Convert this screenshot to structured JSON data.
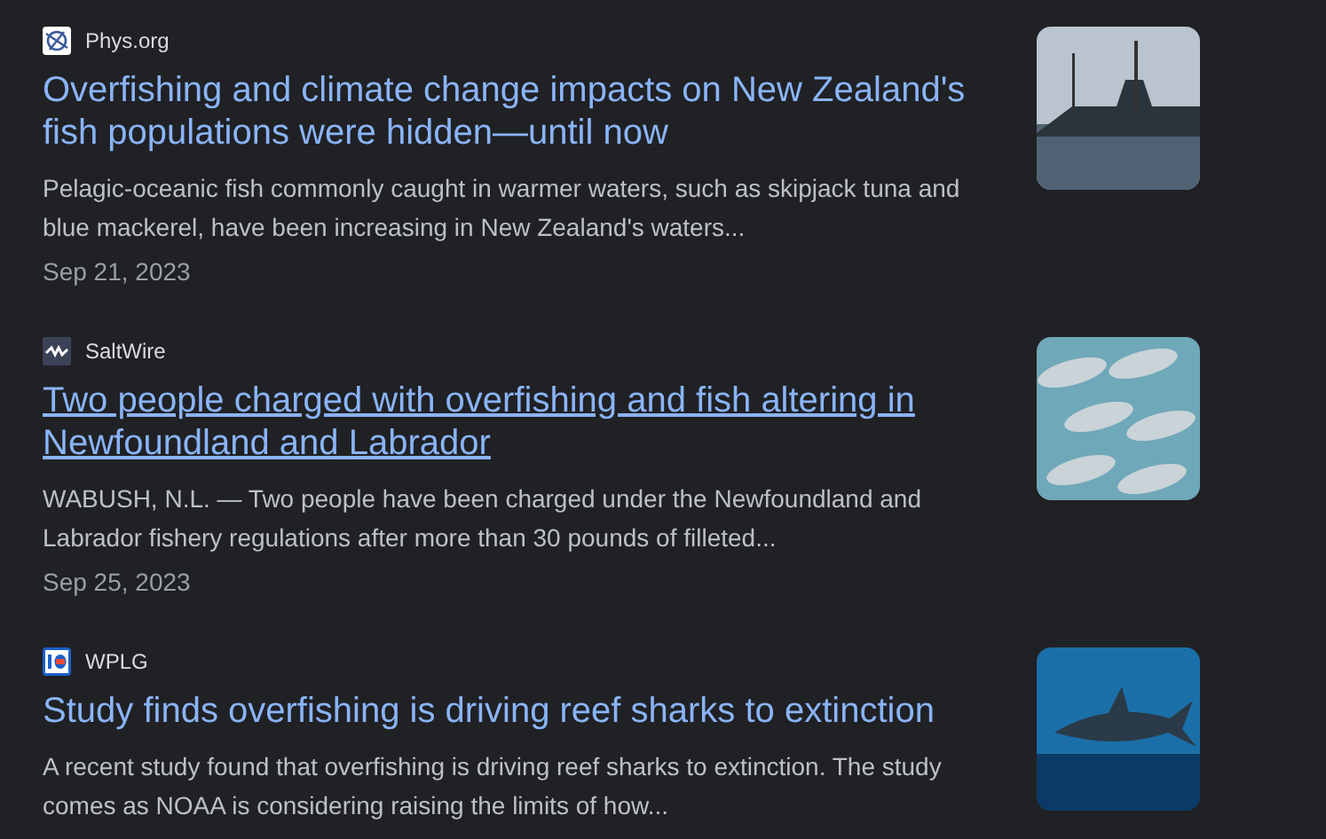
{
  "results": [
    {
      "source": "Phys.org",
      "logo": {
        "kind": "globe"
      },
      "title": "Overfishing and climate change impacts on New Zealand's fish populations were hidden—until now",
      "hovered": false,
      "snippet": "Pelagic-oceanic fish commonly caught in warmer waters, such as skipjack tuna and blue mackerel, have been increasing in New Zealand's waters...",
      "date": "Sep 21, 2023",
      "thumbnail": {
        "kind": "harbor"
      }
    },
    {
      "source": "SaltWire",
      "logo": {
        "kind": "wave"
      },
      "title": "Two people charged with overfishing and fish altering in Newfoundland and Labrador",
      "hovered": true,
      "snippet": "WABUSH, N.L. — Two people have been charged under the Newfoundland and Labrador fishery regulations after more than 30 pounds of filleted...",
      "date": "Sep 25, 2023",
      "thumbnail": {
        "kind": "fish"
      }
    },
    {
      "source": "WPLG",
      "logo": {
        "kind": "channel"
      },
      "title": "Study finds overfishing is driving reef sharks to extinction",
      "hovered": false,
      "snippet": "A recent study found that overfishing is driving reef sharks to extinction. The study comes as NOAA is considering raising the limits of how...",
      "thumbnail": {
        "kind": "shark"
      }
    }
  ]
}
